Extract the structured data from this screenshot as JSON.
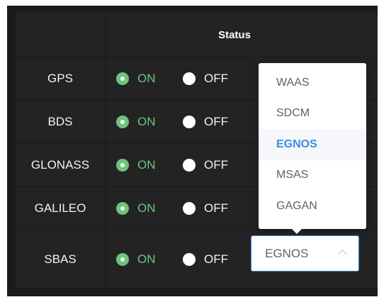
{
  "table": {
    "header": {
      "title": "Status"
    },
    "rows": [
      {
        "name": "GPS",
        "on_label": "ON",
        "off_label": "OFF"
      },
      {
        "name": "BDS",
        "on_label": "ON",
        "off_label": "OFF"
      },
      {
        "name": "GLONASS",
        "on_label": "ON",
        "off_label": "OFF"
      },
      {
        "name": "GALILEO",
        "on_label": "ON",
        "off_label": "OFF"
      },
      {
        "name": "SBAS",
        "on_label": "ON",
        "off_label": "OFF"
      }
    ]
  },
  "sbas_select": {
    "value": "EGNOS",
    "options": [
      "WAAS",
      "SDCM",
      "EGNOS",
      "MSAS",
      "GAGAN"
    ],
    "selected_option": "EGNOS"
  },
  "colors": {
    "on_accent": "#6cc57e",
    "select_accent": "#3a8de0",
    "panel_background": "#232324"
  }
}
